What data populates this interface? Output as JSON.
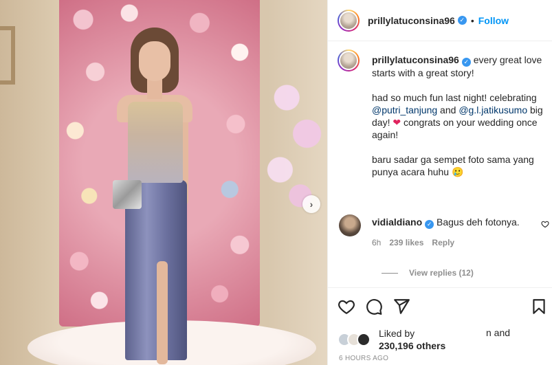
{
  "post": {
    "username": "prillylatuconsina96",
    "verified_icon": "verified-badge-icon",
    "follow_label": "Follow",
    "separator": "•",
    "caption": {
      "line1": "every great love starts with a great story!",
      "para2_a": "had so much fun last night! celebrating ",
      "mention1": "@putri_tanjung",
      "para2_b": " and ",
      "mention2": "@g.l.jatikusumo",
      "para2_c": " big day! ",
      "para2_d": " congrats on your wedding once again!",
      "para3": "baru sadar ga sempet foto sama yang punya acara huhu 🥲",
      "time": "6h"
    },
    "comment": {
      "username": "vidialdiano",
      "text": "Bagus deh fotonya.",
      "time": "6h",
      "likes": "239 likes",
      "reply_label": "Reply",
      "view_replies": "View replies (12)"
    },
    "likes": {
      "liked_by": "Liked by",
      "and": "n and",
      "count": "230,196 others"
    },
    "posted_ago": "6 HOURS AGO"
  },
  "icons": [
    "heart-icon",
    "comment-icon",
    "share-icon",
    "save-icon",
    "carousel-next-icon"
  ],
  "colors": {
    "accent": "#0095f6",
    "mention": "#00376b",
    "muted": "#8e8e8e",
    "heart": "#e0245e"
  }
}
